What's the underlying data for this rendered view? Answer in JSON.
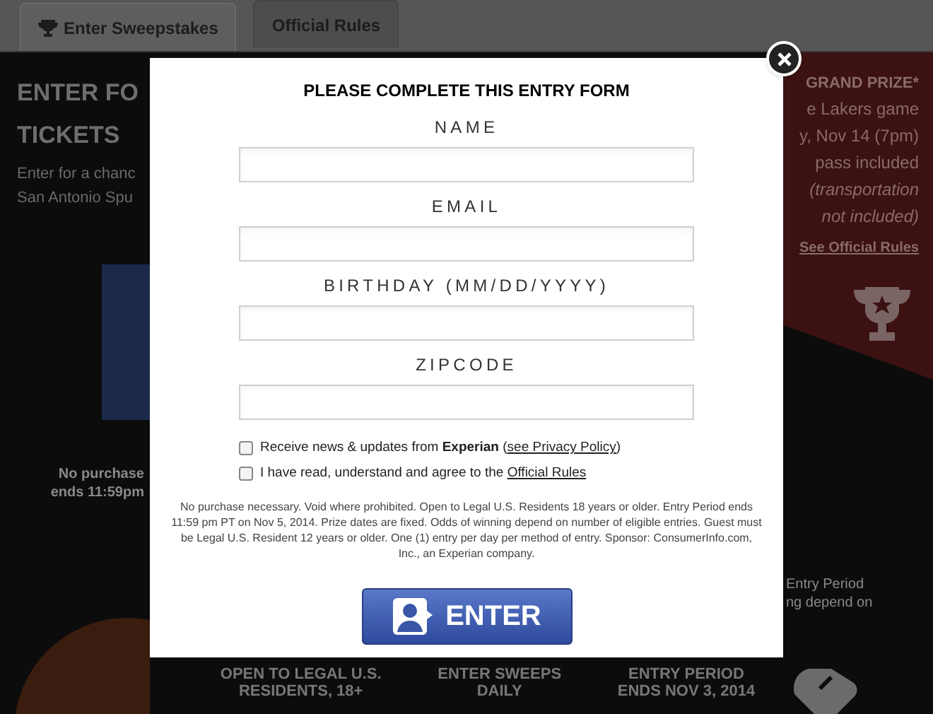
{
  "tabs": [
    {
      "label": "Enter Sweepstakes",
      "selected": true
    },
    {
      "label": "Official Rules",
      "selected": false
    }
  ],
  "hero": {
    "title_lines": [
      "ENTER FO",
      "TICKETS"
    ],
    "intro_lines": [
      "Enter for a chanc",
      "San Antonio Spu"
    ]
  },
  "prize": {
    "lines": [
      "GRAND PRIZE*",
      "e Lakers game",
      "y, Nov 14 (7pm)",
      "pass included"
    ],
    "note_lines": [
      "(transportation",
      "not included)"
    ],
    "rules_link": "See Official Rules"
  },
  "left_notice": [
    "No purchase",
    "ends 11:59pm"
  ],
  "right_notice": [
    "Entry Period",
    "ng depend on"
  ],
  "features": [
    {
      "lines": [
        "OPEN TO LEGAL U.S.",
        "RESIDENTS, 18+"
      ]
    },
    {
      "lines": [
        "ENTER SWEEPS",
        "DAILY"
      ]
    },
    {
      "lines": [
        "ENTRY PERIOD",
        "ENDS NOV 3, 2014"
      ]
    }
  ],
  "modal": {
    "title": "PLEASE COMPLETE THIS ENTRY FORM",
    "fields": [
      {
        "label": "NAME"
      },
      {
        "label": "EMAIL"
      },
      {
        "label": "BIRTHDAY (MM/DD/YYYY)"
      },
      {
        "label": "ZIPCODE"
      }
    ],
    "checkboxes": [
      {
        "before": "Receive news & updates from **Experian** (",
        "link": "see Privacy Policy",
        "after": ")",
        "checked": false
      },
      {
        "before": "I have read, understand and agree to the ",
        "link": "Official Rules",
        "checked": false
      }
    ],
    "fine_print": "No purchase necessary. Void where prohibited. Open to Legal U.S. Residents 18 years or older. Entry Period ends 11:59 pm PT on Nov 5, 2014. Prize dates are fixed. Odds of winning depend on number of eligible entries. Guest must be Legal U.S. Resident 12 years or older. One (1) entry per day per method of entry. Sponsor: ConsumerInfo.com, Inc., an Experian company.",
    "submit": "ENTER"
  }
}
